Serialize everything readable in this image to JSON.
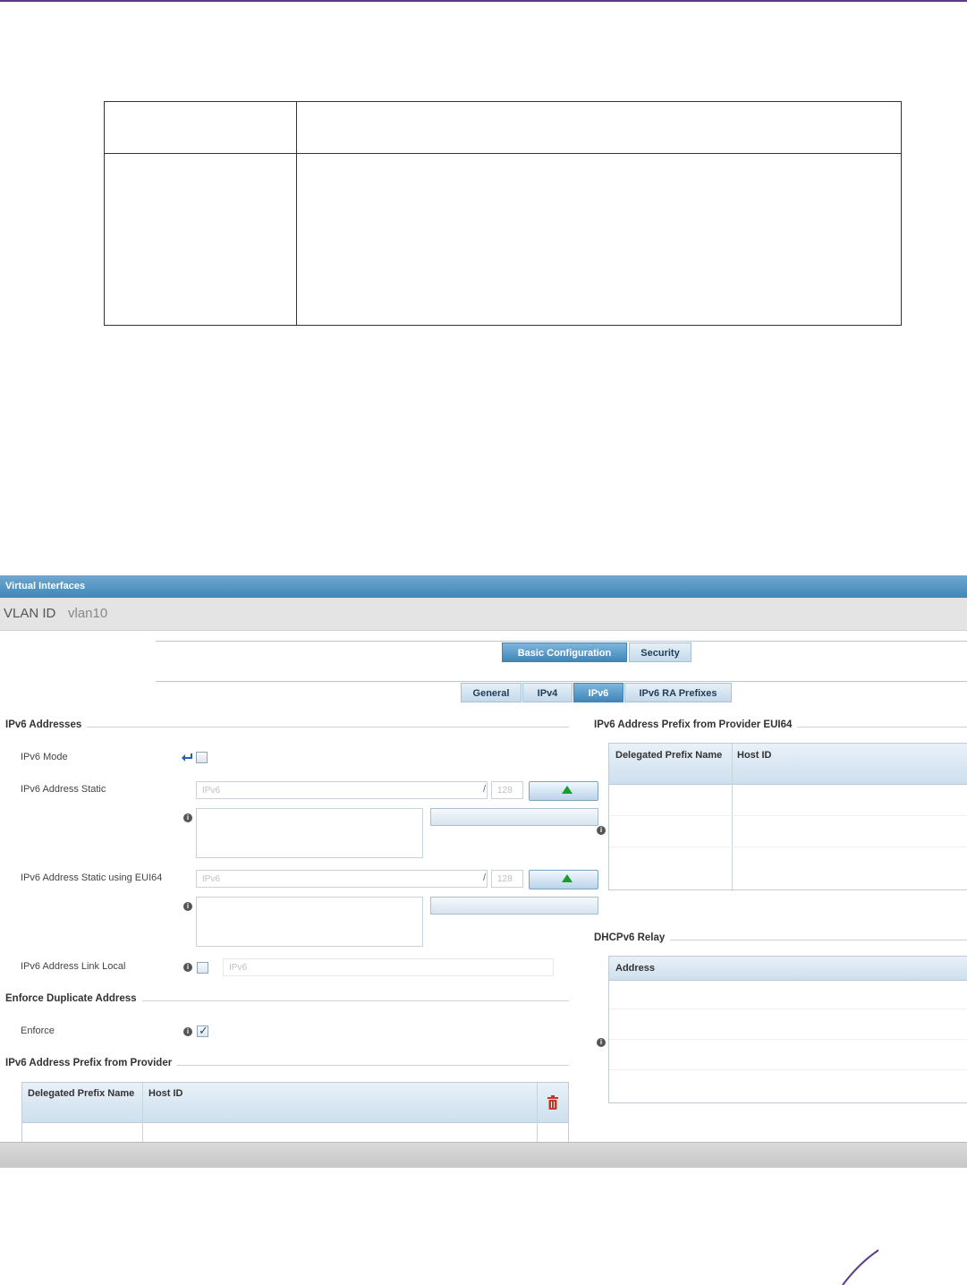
{
  "window": {
    "title": "Virtual Interfaces"
  },
  "vlan": {
    "label": "VLAN ID",
    "value": "vlan10"
  },
  "main_tabs": {
    "basic": "Basic Configuration",
    "security": "Security"
  },
  "sub_tabs": {
    "general": "General",
    "ipv4": "IPv4",
    "ipv6": "IPv6",
    "ra": "IPv6 RA Prefixes"
  },
  "left": {
    "section_addresses": "IPv6 Addresses",
    "ipv6_mode": "IPv6 Mode",
    "static": "IPv6 Address Static",
    "static_placeholder": "IPv6",
    "static_prefix": "128",
    "eui64": "IPv6 Address Static using EUI64",
    "eui64_placeholder": "IPv6",
    "eui64_prefix": "128",
    "link_local": "IPv6 Address Link Local",
    "link_local_placeholder": "IPv6",
    "slash": "/",
    "section_enforce": "Enforce Duplicate Address",
    "enforce": "Enforce",
    "enforce_checked": true,
    "section_provider": "IPv6 Address Prefix from Provider",
    "provider_col1": "Delegated Prefix Name",
    "provider_col2": "Host ID"
  },
  "right": {
    "section_eui64": "IPv6 Address Prefix from Provider EUI64",
    "eui64_col1": "Delegated Prefix Name",
    "eui64_col2": "Host ID",
    "section_relay": "DHCPv6 Relay",
    "relay_col1": "Address"
  },
  "icons": {
    "info": "info-icon",
    "add": "green-up-arrow-icon",
    "delete": "trash-icon",
    "revert": "revert-arrow-icon"
  },
  "colors": {
    "accent": "#3f86b9",
    "brand": "#5b3c8c",
    "delete": "#c0392b",
    "add": "#1c9a2e"
  }
}
